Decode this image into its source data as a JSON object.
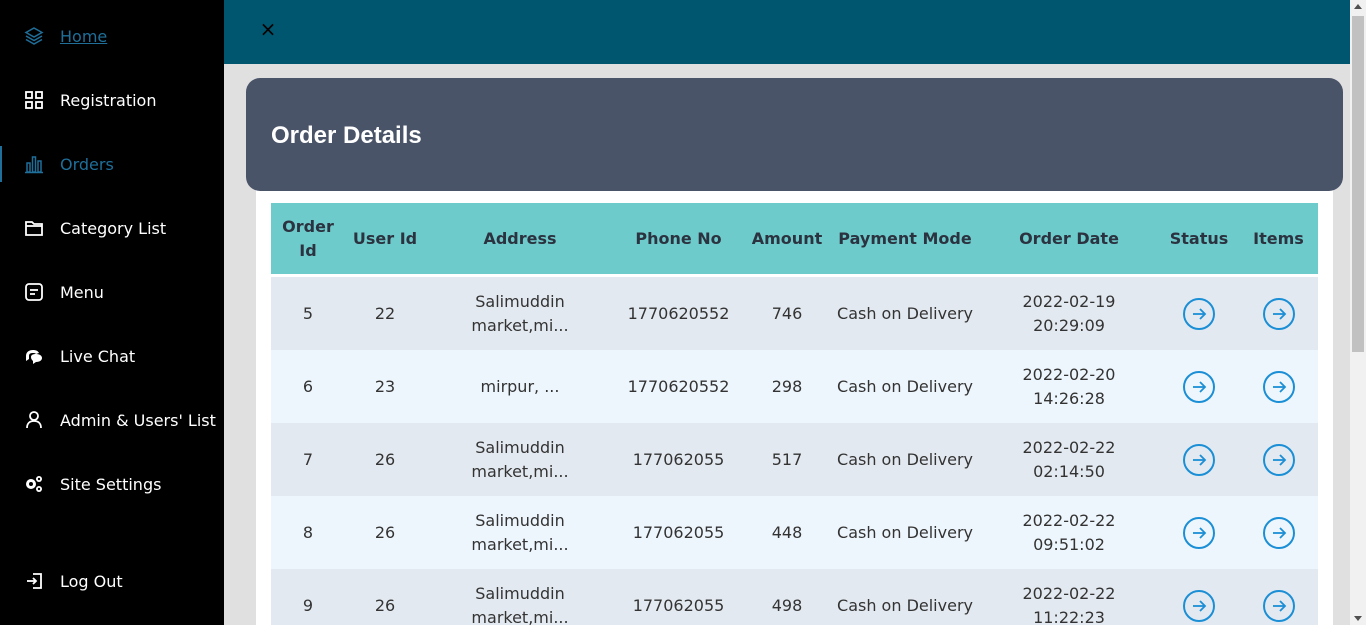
{
  "sidebar": {
    "items": [
      {
        "label": "Home",
        "icon": "layers-icon"
      },
      {
        "label": "Registration",
        "icon": "grid-icon"
      },
      {
        "label": "Orders",
        "icon": "bar-chart-icon"
      },
      {
        "label": "Category List",
        "icon": "folder-icon"
      },
      {
        "label": "Menu",
        "icon": "note-icon"
      },
      {
        "label": "Live Chat",
        "icon": "chat-icon"
      },
      {
        "label": "Admin & Users' List",
        "icon": "user-icon"
      },
      {
        "label": "Site Settings",
        "icon": "gears-icon"
      },
      {
        "label": "Log Out",
        "icon": "logout-icon"
      }
    ]
  },
  "topbar": {
    "close_symbol": "×"
  },
  "header": {
    "title_light": "Order ",
    "title_bold": "Details"
  },
  "table": {
    "columns": [
      "Order Id",
      "User Id",
      "Address",
      "Phone No",
      "Amount",
      "Payment Mode",
      "Order Date",
      "Status",
      "Items"
    ],
    "rows": [
      {
        "order_id": "5",
        "user_id": "22",
        "address": "Salimuddin market,mi...",
        "phone": "1770620552",
        "amount": "746",
        "payment": "Cash on Delivery",
        "date": "2022-02-19 20:29:09"
      },
      {
        "order_id": "6",
        "user_id": "23",
        "address": "mirpur, ...",
        "phone": "1770620552",
        "amount": "298",
        "payment": "Cash on Delivery",
        "date": "2022-02-20 14:26:28"
      },
      {
        "order_id": "7",
        "user_id": "26",
        "address": "Salimuddin market,mi...",
        "phone": "177062055",
        "amount": "517",
        "payment": "Cash on Delivery",
        "date": "2022-02-22 02:14:50"
      },
      {
        "order_id": "8",
        "user_id": "26",
        "address": "Salimuddin market,mi...",
        "phone": "177062055",
        "amount": "448",
        "payment": "Cash on Delivery",
        "date": "2022-02-22 09:51:02"
      },
      {
        "order_id": "9",
        "user_id": "26",
        "address": "Salimuddin market,mi...",
        "phone": "177062055",
        "amount": "498",
        "payment": "Cash on Delivery",
        "date": "2022-02-22 11:22:23"
      }
    ]
  },
  "colors": {
    "sidebar_bg": "#000000",
    "topbar_bg": "#00566e",
    "header_bg": "#4a5469",
    "table_header_bg": "#6ecbcb",
    "accent": "#1b8fd6"
  }
}
